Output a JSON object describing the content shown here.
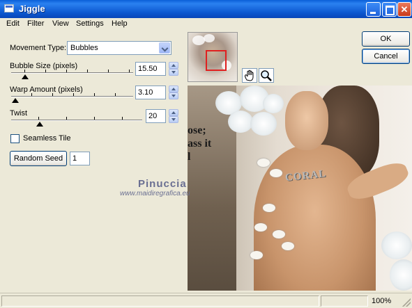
{
  "window": {
    "title": "Jiggle"
  },
  "menu": [
    "Edit",
    "Filter",
    "View",
    "Settings",
    "Help"
  ],
  "controls": {
    "movement_type": {
      "label": "Movement Type:",
      "value": "Bubbles"
    },
    "bubble_size": {
      "label": "Bubble Size (pixels)",
      "value": "15.50"
    },
    "warp_amount": {
      "label": "Warp Amount (pixels)",
      "value": "3.10"
    },
    "twist": {
      "label": "Twist",
      "value": "20"
    },
    "seamless_tile": {
      "label": "Seamless Tile",
      "checked": false
    },
    "random_seed": {
      "button": "Random Seed",
      "value": "1"
    }
  },
  "buttons": {
    "ok": "OK",
    "cancel": "Cancel"
  },
  "preview": {
    "poem_lines": [
      "ose;",
      "ass it",
      "l"
    ],
    "necklace_text": "CORAL"
  },
  "watermark": {
    "line1": "Pinuccia",
    "line2": "www.maidiregrafica.eu"
  },
  "status": {
    "zoom": "100%"
  },
  "colors": {
    "titlebar": "#0a5fd8",
    "dialog_bg": "#ece9d8",
    "selection_rect": "#e02020"
  },
  "icons": [
    "hand-icon",
    "zoom-icon"
  ]
}
